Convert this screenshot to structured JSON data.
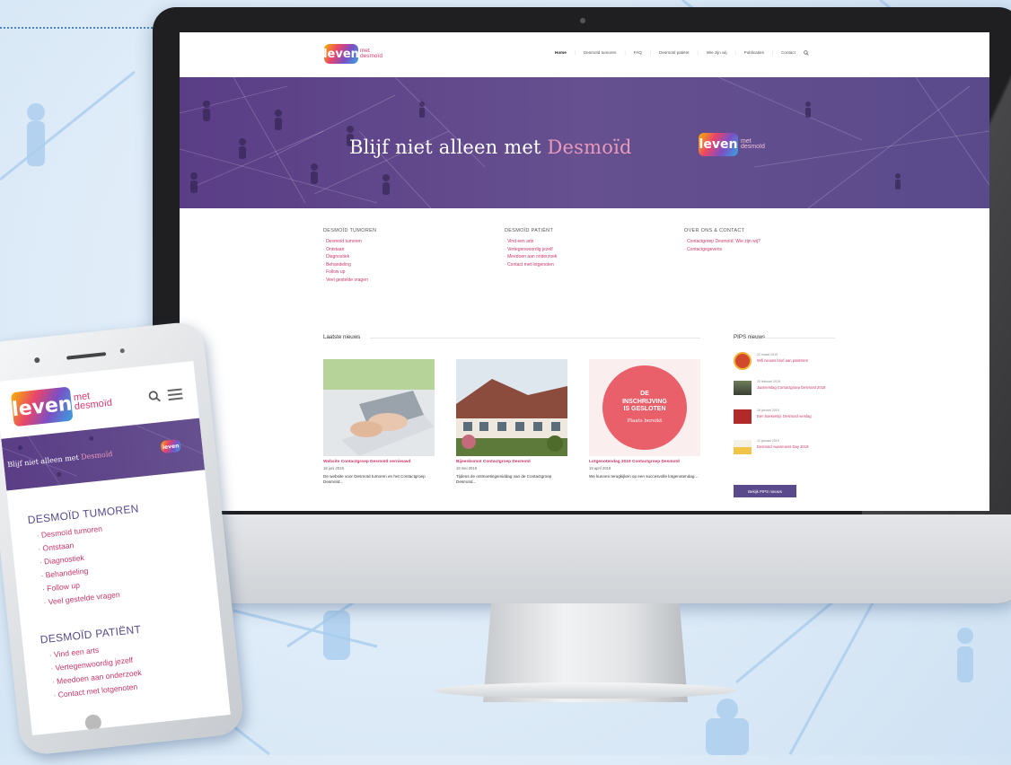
{
  "colors": {
    "accent_pink": "#c9386d",
    "hero_purple": "#5a4a8c",
    "background_blue": "#dceaf7"
  },
  "brand": {
    "logo_main": "leven",
    "logo_sub_line1": "met",
    "logo_sub_line2": "desmoïd"
  },
  "desktop": {
    "nav": [
      "Home",
      "Desmoïd tumoren",
      "FAQ",
      "Desmoïd patiënt",
      "Wie zijn wij",
      "Publicaties",
      "Contact"
    ],
    "search_icon": "search-icon",
    "hero": {
      "title_prefix": "Blijf niet alleen met",
      "title_accent": "Desmoïd"
    },
    "columns": [
      {
        "title": "DESMOÏD TUMOREN",
        "items": [
          "Desmoïd tumoren",
          "Ontstaan",
          "Diagnostiek",
          "Behandeling",
          "Follow up",
          "Veel gestelde vragen"
        ]
      },
      {
        "title": "DESMOÏD PATIËNT",
        "items": [
          "Vind een arts",
          "Vertegenwoordig jezelf",
          "Meedoen aan onderzoek",
          "Contact met lotgenoten"
        ]
      },
      {
        "title": "OVER ONS & CONTACT",
        "items": [
          "Contactgroep Desmoïd: Wie zijn wij?",
          "Contactgegevens"
        ]
      }
    ],
    "news": {
      "title": "Laatste nieuws",
      "cards": [
        {
          "title": "Website Contactgroep Desmoïd vernieuwd",
          "date": "18 juni 2019",
          "text": "De website voor Desmoïd tumoren en het Contactgroep Desmoïd..."
        },
        {
          "title": "Bijeenkomst Contactgroep Desmoïd",
          "date": "18 mei 2019",
          "text": "Tijdens de ontmoetingsmiddag van de Contactgroep Desmoïd..."
        },
        {
          "title": "Lotgenotendag 2019 Contactgroep Desmoïd",
          "date": "19 april 2019",
          "text": "We kunnen terugkijken op een succesvolle lotgenotendag..."
        }
      ],
      "closed_badge_line1": "DE",
      "closed_badge_line2": "INSCHRIJVING",
      "closed_badge_line3": "IS GESLOTEN",
      "closed_badge_line4": "Plaats bereikt"
    },
    "pips": {
      "title": "PIPS nieuws",
      "items": [
        {
          "date": "22 maart 2019",
          "text": "Wifi nieuws brief aan patiënten"
        },
        {
          "date": "20 februari 2019",
          "text": "Jaarverslag Contactgroep Desmoïd 2018"
        },
        {
          "date": "18 januari 2019",
          "text": "Een boekentip: Desmoïd verslag"
        },
        {
          "date": "12 januari 2019",
          "text": "Desmoïd Awareness Day 2019"
        }
      ],
      "button": "Bekijk PIPS nieuws"
    }
  },
  "phone": {
    "hero": {
      "title_prefix": "Blijf niet alleen met",
      "title_accent": "Desmoïd"
    },
    "sections": [
      {
        "title": "DESMOÏD TUMOREN",
        "items": [
          "Desmoïd tumoren",
          "Ontstaan",
          "Diagnostiek",
          "Behandeling",
          "Follow up",
          "Veel gestelde vragen"
        ]
      },
      {
        "title": "DESMOÏD PATIËNT",
        "items": [
          "Vind een arts",
          "Vertegenwoordig jezelf",
          "Meedoen aan onderzoek",
          "Contact met lotgenoten"
        ]
      }
    ]
  }
}
